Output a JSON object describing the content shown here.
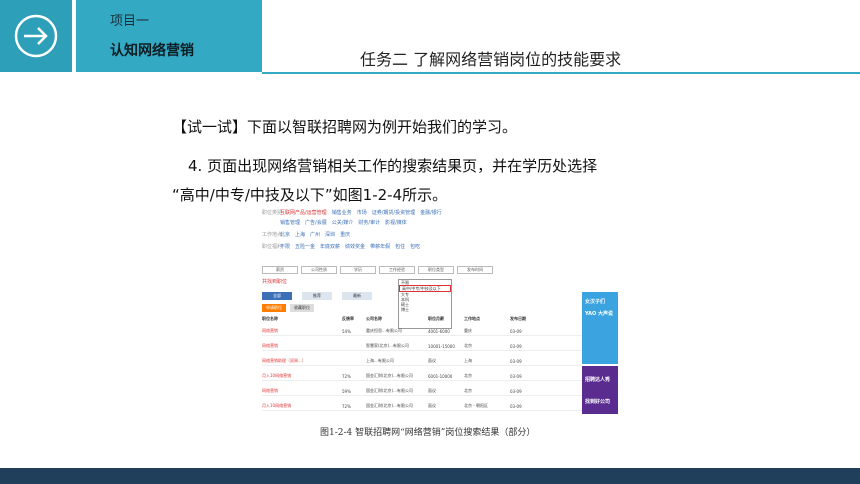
{
  "header": {
    "project_label": "项目一",
    "project_title": "认知网络营销",
    "task_title": "任务二  了解网络营销岗位的技能要求",
    "accent_color": "#34a9c4",
    "logo_icon": "arrow-circle-right-icon"
  },
  "body": {
    "p1": "【试一试】下面以智联招聘网为例开始我们的学习。",
    "p2": "4. 页面出现网络营销相关工作的搜索结果页，并在学历处选择",
    "p3": "“高中/中专/中技及以下”如图1-2-4所示。"
  },
  "figure": {
    "caption": "图1-2-4    智联招聘网“网络营销”岗位搜索结果（部分）",
    "table_headers": [
      "职位名称",
      "反馈率",
      "公司名称",
      "职位月薪",
      "工作地点",
      "发布日期"
    ],
    "rows": [
      {
        "title": "网络营销",
        "rate": "54%",
        "company": "重庆恒思...有限公司",
        "salary": "4001-6000",
        "city": "重庆",
        "date": "03-09"
      },
      {
        "title": "网络营销",
        "rate": "",
        "company": "智慧家(北京)...有限公司",
        "salary": "10001-15000",
        "city": "北京",
        "date": "03-09"
      },
      {
        "title": "网络营销助理（双周...）",
        "rate": "",
        "company": "上海...有限公司",
        "salary": "面议",
        "city": "上海",
        "date": "03-09"
      },
      {
        "title": "月入10网络营销",
        "rate": "72%",
        "company": "国金汇财(北京)...有限公司",
        "salary": "6001-10000",
        "city": "北京",
        "date": "03-09"
      },
      {
        "title": "网络营销",
        "rate": "59%",
        "company": "国金汇财(北京)...有限公司",
        "salary": "面议",
        "city": "北京",
        "date": "03-09"
      },
      {
        "title": "月入10网络营销",
        "rate": "72%",
        "company": "国金汇财(北京)...有限公司",
        "salary": "面议",
        "city": "北京 - 朝阳区",
        "date": "03-09"
      }
    ],
    "popup_options": [
      "不限",
      "高中/中专/中技及以下",
      "大专",
      "本科",
      "硕士",
      "博士"
    ],
    "buttons": {
      "apply": "申请职位",
      "save": "收藏职位"
    }
  }
}
